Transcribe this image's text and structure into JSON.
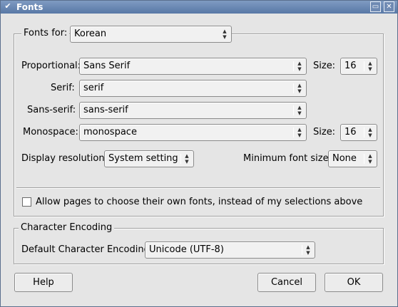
{
  "window": {
    "title": "Fonts"
  },
  "fonts_group": {
    "fonts_for_label": "Fonts for:",
    "fonts_for_value": "Korean",
    "proportional_label": "Proportional:",
    "proportional_value": "Sans Serif",
    "size_label": "Size:",
    "proportional_size": "16",
    "serif_label": "Serif:",
    "serif_value": "serif",
    "sans_serif_label": "Sans-serif:",
    "sans_serif_value": "sans-serif",
    "monospace_label": "Monospace:",
    "monospace_value": "monospace",
    "monospace_size": "16",
    "display_resolution_label": "Display resolution:",
    "display_resolution_value": "System setting",
    "min_font_size_label": "Minimum font size:",
    "min_font_size_value": "None",
    "allow_pages_label": "Allow pages to choose their own fonts, instead of my selections above",
    "allow_pages_checked": false
  },
  "encoding_group": {
    "legend": "Character Encoding",
    "default_encoding_label": "Default Character Encoding:",
    "default_encoding_value": "Unicode (UTF-8)"
  },
  "buttons": {
    "help": "Help",
    "cancel": "Cancel",
    "ok": "OK"
  }
}
